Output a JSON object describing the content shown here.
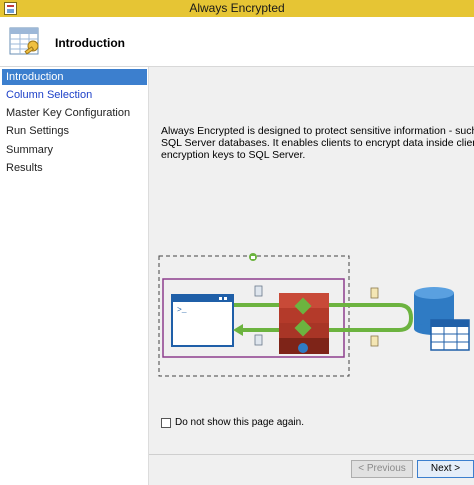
{
  "window": {
    "title": "Always Encrypted"
  },
  "header": {
    "title": "Introduction",
    "icon": "wizard-table-key-icon"
  },
  "sidebar": {
    "items": [
      {
        "label": "Introduction"
      },
      {
        "label": "Column Selection"
      },
      {
        "label": "Master Key Configuration"
      },
      {
        "label": "Run Settings"
      },
      {
        "label": "Summary"
      },
      {
        "label": "Results"
      }
    ]
  },
  "main": {
    "description_lines": [
      "Always Encrypted is designed to protect sensitive information - such as credit card numbers - stored in",
      "SQL Server databases. It enables clients to encrypt data inside client applications and never reveal the",
      "encryption keys to SQL Server."
    ],
    "dont_show_label": "Do not show this page again.",
    "dont_show_checked": false
  },
  "footer": {
    "previous_label": "< Previous",
    "next_label": "Next >"
  },
  "colors": {
    "titlebar": "#e6c534",
    "selection": "#3c7fce",
    "link": "#1d40c8",
    "arrow": "#6cb33f",
    "database": "#2f7bc4",
    "server": "#b43a2a",
    "frame": "#8e3e8e"
  }
}
